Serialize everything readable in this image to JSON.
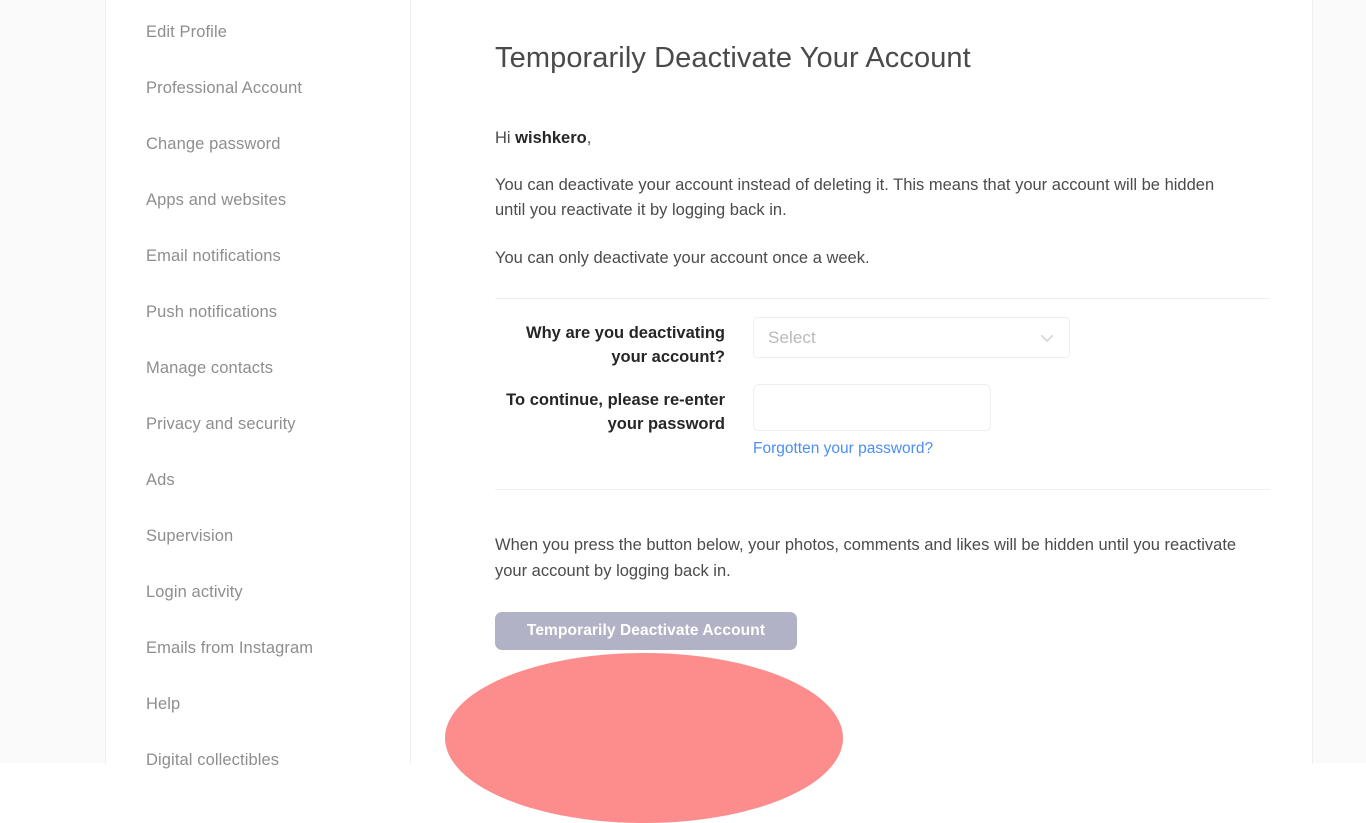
{
  "sidebar": {
    "items": [
      {
        "label": "Edit Profile",
        "active": false
      },
      {
        "label": "Professional Account",
        "active": false
      },
      {
        "label": "Change password",
        "active": false
      },
      {
        "label": "Apps and websites",
        "active": false
      },
      {
        "label": "Email notifications",
        "active": false
      },
      {
        "label": "Push notifications",
        "active": false
      },
      {
        "label": "Manage contacts",
        "active": false
      },
      {
        "label": "Privacy and security",
        "active": false
      },
      {
        "label": "Ads",
        "active": false
      },
      {
        "label": "Supervision",
        "active": false
      },
      {
        "label": "Login activity",
        "active": false
      },
      {
        "label": "Emails from Instagram",
        "active": false
      },
      {
        "label": "Help",
        "active": false
      },
      {
        "label": "Digital collectibles",
        "active": false
      }
    ]
  },
  "main": {
    "title": "Temporarily Deactivate Your Account",
    "greeting_prefix": "Hi ",
    "username": "wishkero",
    "greeting_suffix": ",",
    "paragraph_1": "You can deactivate your account instead of deleting it. This means that your account will be hidden until you reactivate it by logging back in.",
    "paragraph_2": "You can only deactivate your account once a week.",
    "form": {
      "reason_label": "Why are you deactivating your account?",
      "reason_value": "Select",
      "reason_icon": "chevron-down-icon",
      "password_label": "To continue, please re-enter your password",
      "password_value": "",
      "password_placeholder": "",
      "forgot_password_link": "Forgotten your password?"
    },
    "bottom_note": "When you press the button below, your photos, comments and likes will be hidden until you reactivate your account by logging back in.",
    "deactivate_button_label": "Temporarily Deactivate Account"
  },
  "colors": {
    "page_background": "#fafafa",
    "card_background": "#ffffff",
    "border": "#efefef",
    "sidebar_text": "#8e8e8e",
    "body_text": "#4b4b4b",
    "heading_text": "#4a4a4a",
    "label_text": "#262626",
    "link_blue": "#4b8ef5",
    "button_disabled": "#b2b2c6",
    "highlight_red": "#fc5f5f",
    "placeholder_text": "#b9b9b9"
  },
  "annotation": {
    "type": "highlight-oval",
    "target": "deactivate-button"
  }
}
